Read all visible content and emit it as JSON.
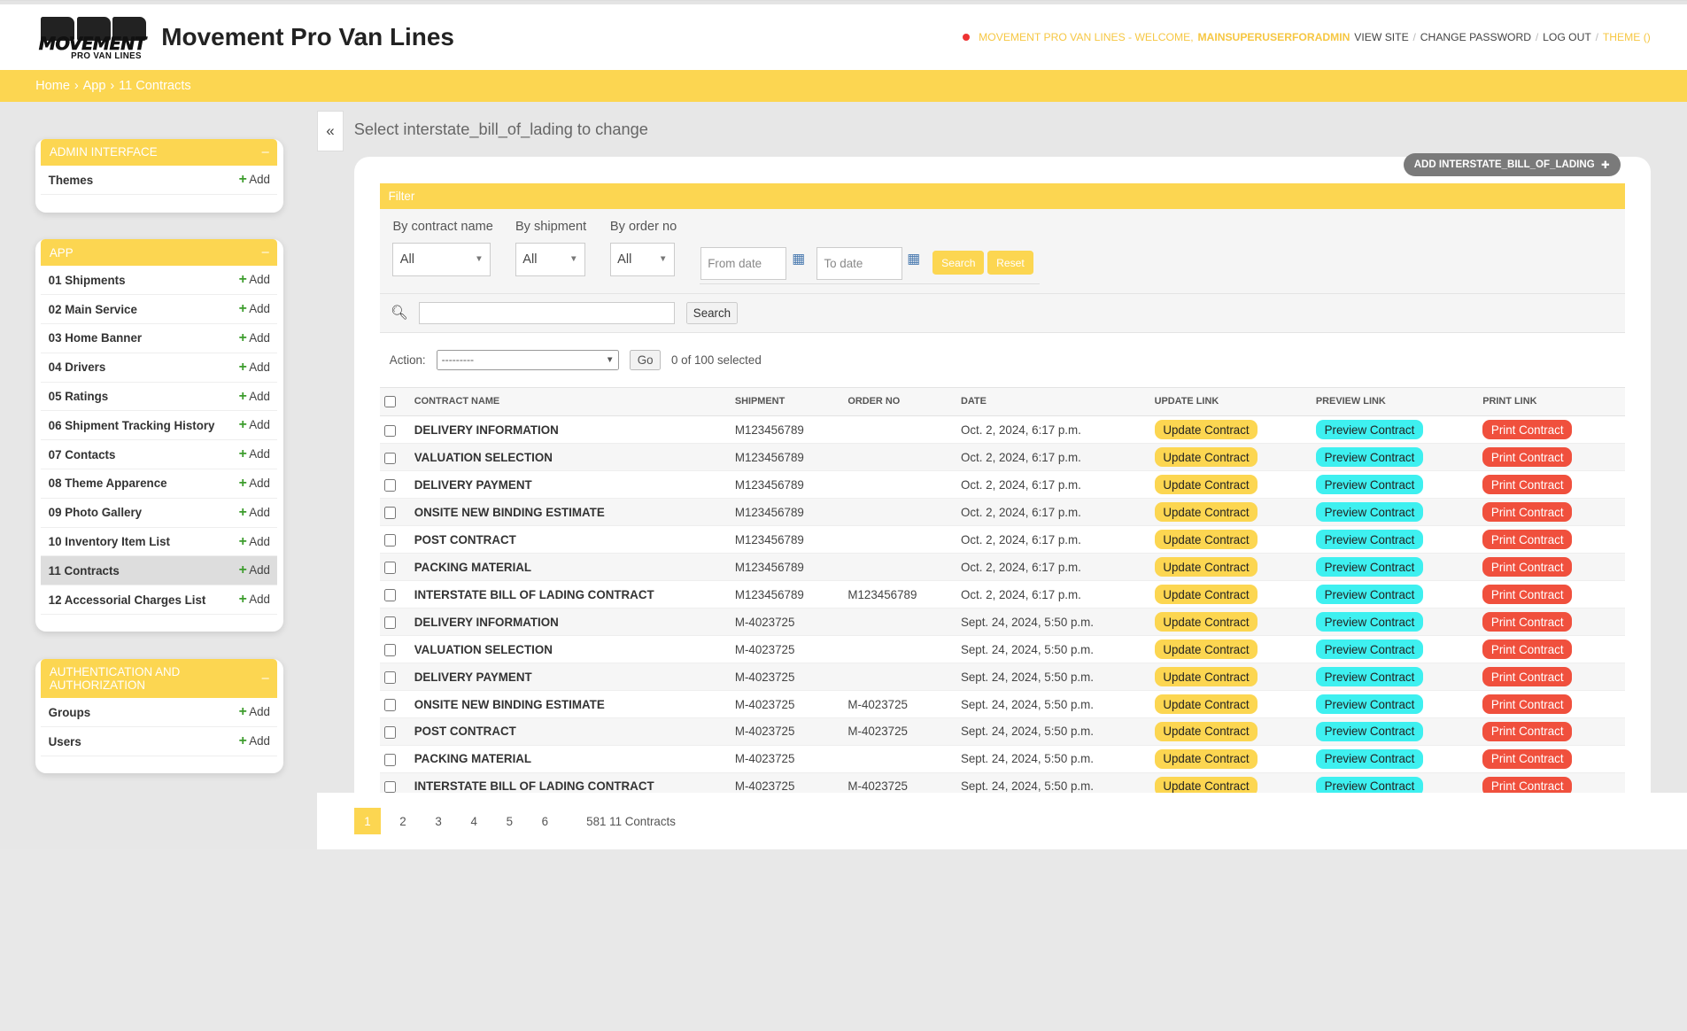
{
  "header": {
    "site_name": "Movement Pro Van Lines",
    "logo_word": "MOVEMENT",
    "logo_sub": "PRO VAN LINES",
    "welcome": "MOVEMENT PRO VAN LINES - WELCOME,",
    "username": "MAINSUPERUSERFORADMIN",
    "view_site": "VIEW SITE",
    "change_password": "CHANGE PASSWORD",
    "log_out": "LOG OUT",
    "theme": "THEME ()",
    "sep": "/"
  },
  "breadcrumbs": {
    "home": "Home",
    "app": "App",
    "current": "11 Contracts",
    "sep": "›"
  },
  "sidebar": {
    "add_label": "Add",
    "modules": [
      {
        "title": "ADMIN INTERFACE",
        "items": [
          "Themes"
        ]
      },
      {
        "title": "APP",
        "items": [
          "01 Shipments",
          "02 Main Service",
          "03 Home Banner",
          "04 Drivers",
          "05 Ratings",
          "06 Shipment Tracking History",
          "07 Contacts",
          "08 Theme Apparence",
          "09 Photo Gallery",
          "10 Inventory Item List",
          "11 Contracts",
          "12 Accessorial Charges List"
        ]
      },
      {
        "title": "AUTHENTICATION AND AUTHORIZATION",
        "items": [
          "Groups",
          "Users"
        ]
      }
    ],
    "minimize": "–"
  },
  "toggle": "«",
  "content": {
    "title": "Select interstate_bill_of_lading to change",
    "add_button": "ADD INTERSTATE_BILL_OF_LADING"
  },
  "filter": {
    "heading": "Filter",
    "contract_label": "By contract name",
    "contract_value": "All",
    "shipment_label": "By shipment",
    "shipment_value": "All",
    "order_label": "By order no",
    "order_value": "All",
    "from_placeholder": "From date",
    "to_placeholder": "To date",
    "search": "Search",
    "reset": "Reset"
  },
  "search": {
    "button": "Search"
  },
  "actions": {
    "label": "Action:",
    "select_value": "---------",
    "go": "Go",
    "selected": "0 of 100 selected"
  },
  "table": {
    "headers": [
      "CONTRACT NAME",
      "SHIPMENT",
      "ORDER NO",
      "DATE",
      "UPDATE LINK",
      "PREVIEW LINK",
      "PRINT LINK"
    ],
    "update_label": "Update Contract",
    "preview_label": "Preview Contract",
    "print_label": "Print Contract",
    "rows": [
      {
        "name": "DELIVERY INFORMATION",
        "shipment": "M123456789",
        "order": "",
        "date": "Oct. 2, 2024, 6:17 p.m."
      },
      {
        "name": "VALUATION SELECTION",
        "shipment": "M123456789",
        "order": "",
        "date": "Oct. 2, 2024, 6:17 p.m."
      },
      {
        "name": "DELIVERY PAYMENT",
        "shipment": "M123456789",
        "order": "",
        "date": "Oct. 2, 2024, 6:17 p.m."
      },
      {
        "name": "ONSITE NEW BINDING ESTIMATE",
        "shipment": "M123456789",
        "order": "",
        "date": "Oct. 2, 2024, 6:17 p.m."
      },
      {
        "name": "POST CONTRACT",
        "shipment": "M123456789",
        "order": "",
        "date": "Oct. 2, 2024, 6:17 p.m."
      },
      {
        "name": "PACKING MATERIAL",
        "shipment": "M123456789",
        "order": "",
        "date": "Oct. 2, 2024, 6:17 p.m."
      },
      {
        "name": "INTERSTATE BILL OF LADING CONTRACT",
        "shipment": "M123456789",
        "order": "M123456789",
        "date": "Oct. 2, 2024, 6:17 p.m."
      },
      {
        "name": "DELIVERY INFORMATION",
        "shipment": "M-4023725",
        "order": "",
        "date": "Sept. 24, 2024, 5:50 p.m."
      },
      {
        "name": "VALUATION SELECTION",
        "shipment": "M-4023725",
        "order": "",
        "date": "Sept. 24, 2024, 5:50 p.m."
      },
      {
        "name": "DELIVERY PAYMENT",
        "shipment": "M-4023725",
        "order": "",
        "date": "Sept. 24, 2024, 5:50 p.m."
      },
      {
        "name": "ONSITE NEW BINDING ESTIMATE",
        "shipment": "M-4023725",
        "order": "M-4023725",
        "date": "Sept. 24, 2024, 5:50 p.m."
      },
      {
        "name": "POST CONTRACT",
        "shipment": "M-4023725",
        "order": "M-4023725",
        "date": "Sept. 24, 2024, 5:50 p.m."
      },
      {
        "name": "PACKING MATERIAL",
        "shipment": "M-4023725",
        "order": "",
        "date": "Sept. 24, 2024, 5:50 p.m."
      },
      {
        "name": "INTERSTATE BILL OF LADING CONTRACT",
        "shipment": "M-4023725",
        "order": "M-4023725",
        "date": "Sept. 24, 2024, 5:50 p.m."
      }
    ]
  },
  "pagination": {
    "pages": [
      "1",
      "2",
      "3",
      "4",
      "5",
      "6"
    ],
    "current": "1",
    "count": "581 11 Contracts"
  },
  "colors": {
    "accent": "#fcd651",
    "update": "#fcd651",
    "preview": "#3ef0f0",
    "print": "#f0503d"
  }
}
